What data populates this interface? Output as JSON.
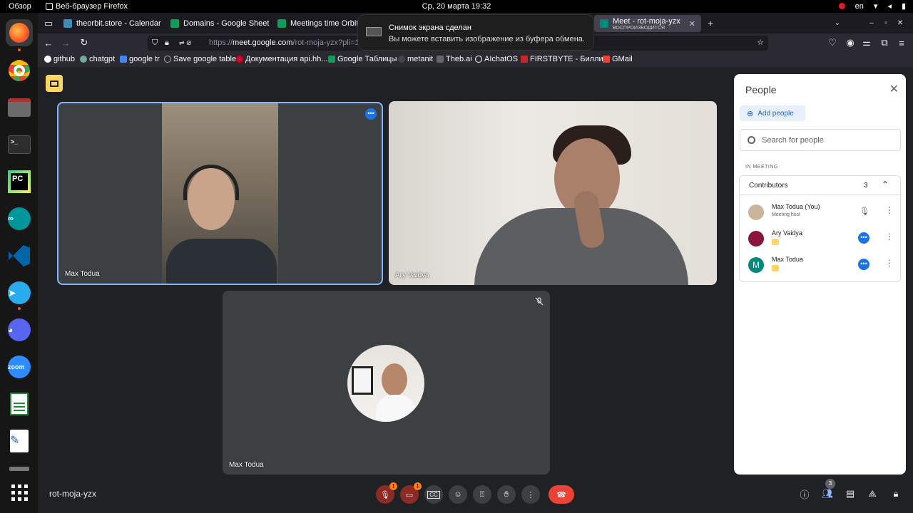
{
  "topbar": {
    "overview": "Обзор",
    "app_name": "Веб-браузер Firefox",
    "clock": "Ср, 20 марта  19:32",
    "lang": "en"
  },
  "tabs": [
    {
      "label": "theorbit.store - Calendar",
      "color": "#3c8dbc"
    },
    {
      "label": "Domains - Google Sheets",
      "color": "#0f9d58"
    },
    {
      "label": "Meetings time Orbit -",
      "color": "#0f9d58"
    },
    {
      "label": "Meet - rot-moja-yzx",
      "sublabel": "ВОСПРОИЗВОДИТСЯ",
      "color": "#00897b"
    }
  ],
  "url": {
    "prefix": "https://",
    "host": "meet.google.com",
    "path": "/rot-moja-yzx?pli=1"
  },
  "bookmarks": [
    {
      "label": "github",
      "color": "#ffffff"
    },
    {
      "label": "chatgpt",
      "color": "#74aa9c"
    },
    {
      "label": "google tr",
      "color": "#4285f4"
    },
    {
      "label": "Save google table",
      "color": "#aaaaaa"
    },
    {
      "label": "Документация api.hh...",
      "color": "#d6001c"
    },
    {
      "label": "Google Таблицы",
      "color": "#0f9d58"
    },
    {
      "label": "metanit",
      "color": "#444444"
    },
    {
      "label": "Theb.ai",
      "color": "#666666"
    },
    {
      "label": "AIchatOS",
      "color": "#ffffff"
    },
    {
      "label": "FIRSTBYTE - Биллинг",
      "color": "#c62828"
    },
    {
      "label": "GMail",
      "color": "#ea4335"
    }
  ],
  "notification": {
    "title": "Снимок экрана сделан",
    "body": "Вы можете вставить изображение из буфера обмена."
  },
  "tiles": [
    {
      "name": "Max Todua"
    },
    {
      "name": "Ary Vaidya"
    },
    {
      "name": "Max Todua"
    }
  ],
  "people_panel": {
    "title": "People",
    "add_people": "Add people",
    "search_placeholder": "Search for people",
    "section": "IN MEETING",
    "group_label": "Contributors",
    "group_count": "3",
    "people": [
      {
        "name": "Max Todua (You)",
        "sub": "Meeting host",
        "avatar_color": "#c8b59c",
        "initial": ""
      },
      {
        "name": "Ary Vaidya",
        "sub": "",
        "avatar_color": "#8a1538",
        "initial": ""
      },
      {
        "name": "Max Todua",
        "sub": "",
        "avatar_color": "#00897b",
        "initial": "M"
      }
    ]
  },
  "meeting_code": "rot-moja-yzx",
  "people_count": "3"
}
